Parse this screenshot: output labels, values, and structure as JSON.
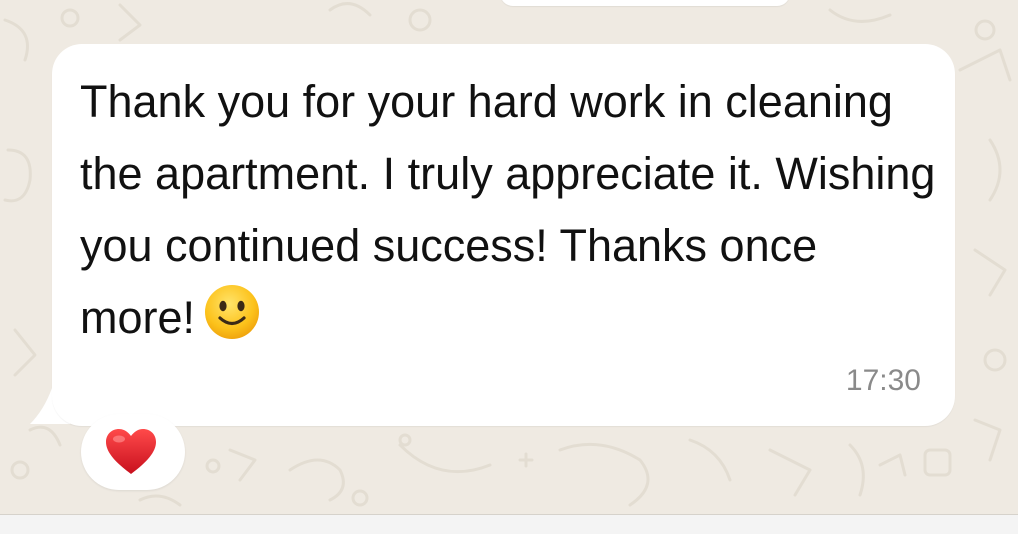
{
  "message": {
    "text": "Thank you for your hard work in cleaning the apartment. I truly appreciate it. Wishing you continued success! Thanks once more!",
    "emoji": "slightly-smiling-face-icon",
    "time": "17:30"
  },
  "reaction": {
    "emoji": "red-heart-icon"
  },
  "colors": {
    "wallpaper": "#efeae2",
    "bubble": "#ffffff",
    "text": "#111111",
    "timestamp": "#8a8a8a",
    "heart": "#e0242f"
  }
}
